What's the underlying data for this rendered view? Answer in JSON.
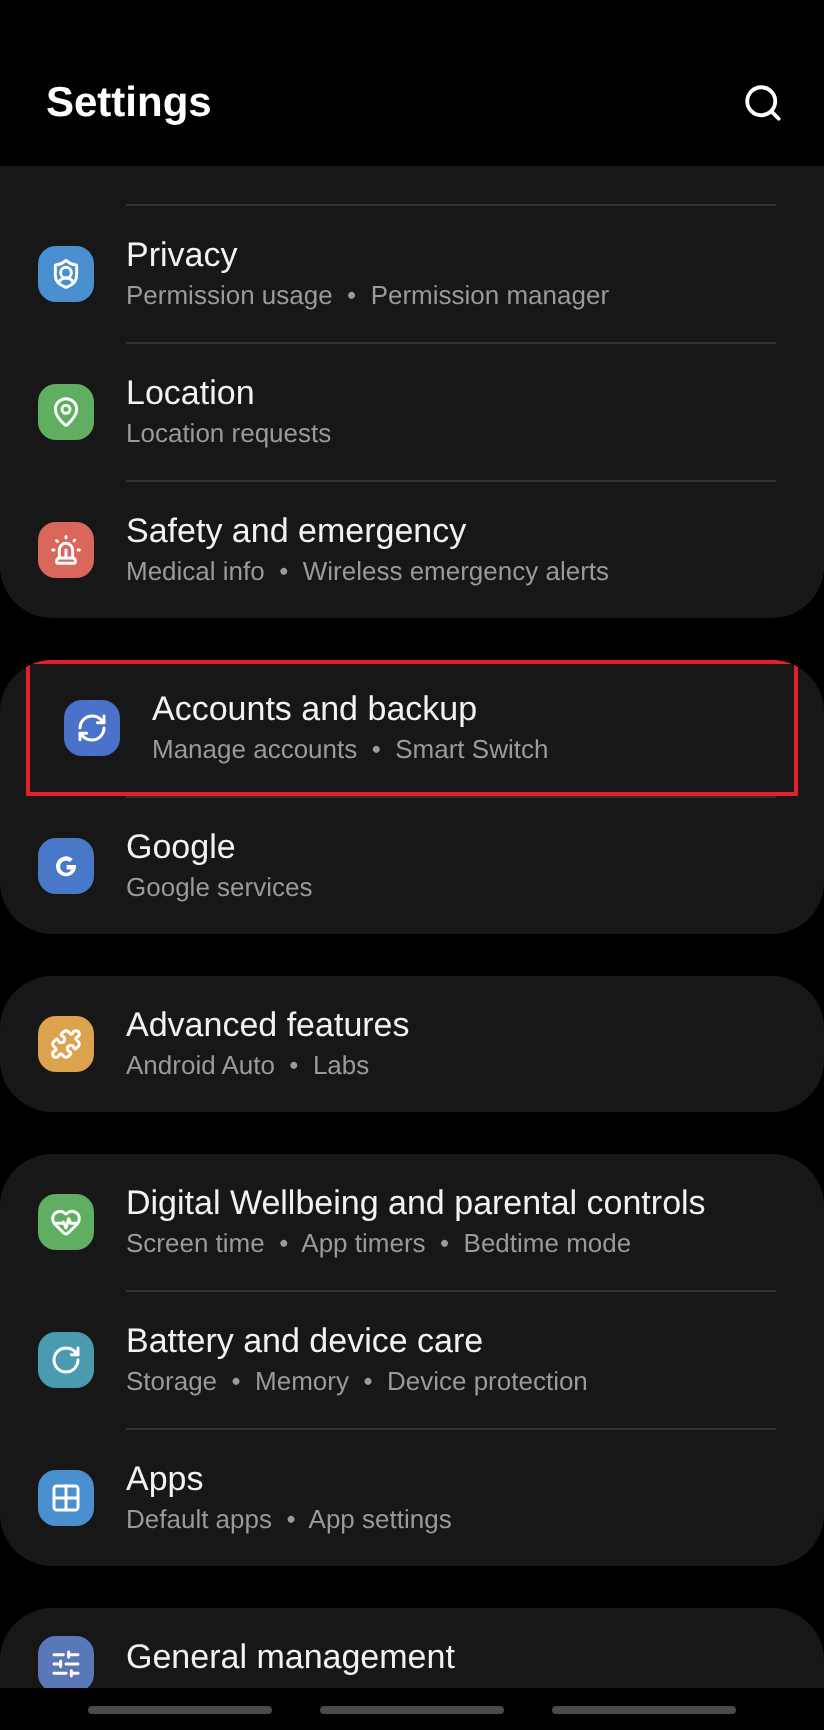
{
  "header": {
    "title": "Settings"
  },
  "groups": [
    {
      "cut_top": true,
      "items": [
        {
          "title": "Privacy",
          "subtitle": "Permission usage  •  Permission manager",
          "color": "#4a8fd0",
          "highlighted": false
        },
        {
          "title": "Location",
          "subtitle": "Location requests",
          "color": "#5fae62",
          "highlighted": false
        },
        {
          "title": "Safety and emergency",
          "subtitle": "Medical info  •  Wireless emergency alerts",
          "color": "#d9675c",
          "highlighted": false
        }
      ]
    },
    {
      "cut_top": false,
      "items": [
        {
          "title": "Accounts and backup",
          "subtitle": "Manage accounts  •  Smart Switch",
          "color": "#4a72c8",
          "highlighted": true
        },
        {
          "title": "Google",
          "subtitle": "Google services",
          "color": "#4a78c8",
          "highlighted": false
        }
      ]
    },
    {
      "cut_top": false,
      "items": [
        {
          "title": "Advanced features",
          "subtitle": "Android Auto  •  Labs",
          "color": "#dca24e",
          "highlighted": false
        }
      ]
    },
    {
      "cut_top": false,
      "items": [
        {
          "title": "Digital Wellbeing and parental controls",
          "subtitle": "Screen time  •  App timers  •  Bedtime mode",
          "color": "#5fae62",
          "highlighted": false
        },
        {
          "title": "Battery and device care",
          "subtitle": "Storage  •  Memory  •  Device protection",
          "color": "#4a9bb0",
          "highlighted": false
        },
        {
          "title": "Apps",
          "subtitle": "Default apps  •  App settings",
          "color": "#4a8fd0",
          "highlighted": false
        }
      ]
    },
    {
      "cut_top": false,
      "cut_bottom": true,
      "items": [
        {
          "title": "General management",
          "color": "#5a78b8",
          "highlighted": false
        }
      ]
    }
  ]
}
